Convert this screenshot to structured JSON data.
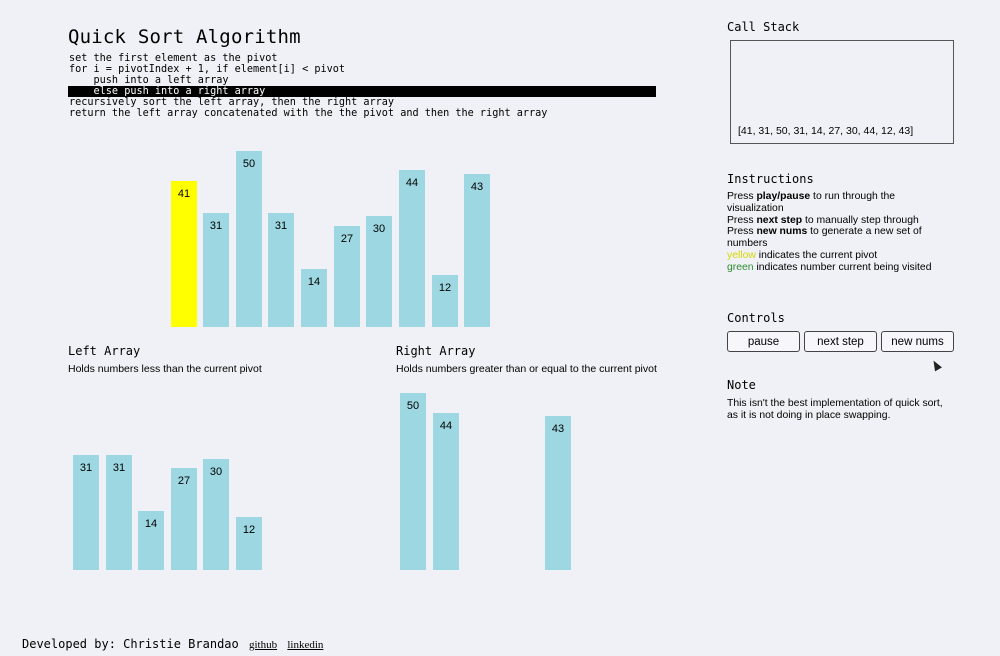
{
  "title": "Quick Sort Algorithm",
  "pseudocode": [
    "set the first element as the pivot",
    "for i = pivotIndex + 1, if element[i] < pivot",
    "    push into a left array",
    "    else push into a right array",
    "recursively sort the left array, then the right array",
    "return the left array concatenated with the the pivot and then the right array"
  ],
  "highlighted_line": 3,
  "main_array": [
    41,
    31,
    50,
    31,
    14,
    27,
    30,
    44,
    12,
    43
  ],
  "pivot_index": 0,
  "left_array": {
    "heading": "Left Array",
    "description": "Holds numbers less than the current pivot",
    "values": [
      "31",
      "31",
      "14",
      "27",
      "30",
      "12"
    ]
  },
  "right_array": {
    "heading": "Right Array",
    "description": "Holds numbers greater than or equal to the current pivot",
    "values": [
      "50",
      "44",
      "43"
    ]
  },
  "call_stack": {
    "heading": "Call Stack",
    "entries": [
      "[41, 31, 50, 31, 14, 27, 30, 44, 12, 43]"
    ]
  },
  "instructions": {
    "heading": "Instructions",
    "play_pre": "Press ",
    "play_bold": "play/pause",
    "play_post": " to run through the visualization",
    "next_pre": "Press ",
    "next_bold": "next step",
    "next_post": " to manually step through",
    "new_pre": "Press ",
    "new_bold": "new nums",
    "new_post": " to generate a new set of numbers",
    "yellow_word": "yellow",
    "yellow_post": " indicates the current pivot",
    "green_word": "green",
    "green_post": " indicates number current being visited"
  },
  "controls": {
    "heading": "Controls",
    "pause_label": "pause",
    "next_label": "next step",
    "new_label": "new nums"
  },
  "note": {
    "heading": "Note",
    "text": "This isn't the best implementation of quick sort, as it is not doing in place swapping."
  },
  "footer": {
    "text": "Developed by: Christie Brandao",
    "github": "github",
    "linkedin": "linkedin"
  },
  "colors": {
    "bar": "#9dd8e2",
    "pivot": "#ffff00",
    "visiting": "#2e8b2e",
    "background": "#f0f1f6"
  }
}
